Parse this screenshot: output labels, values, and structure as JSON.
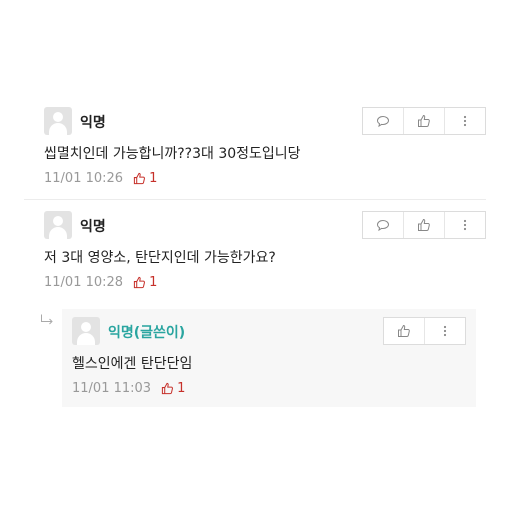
{
  "comments": [
    {
      "author": "익명",
      "text": "씹멸치인데 가능합니까??3대 30정도입니당",
      "date": "11/01 10:26",
      "likes": "1"
    },
    {
      "author": "익명",
      "text": "저 3대 영양소, 탄단지인데 가능한가요?",
      "date": "11/01 10:28",
      "likes": "1"
    }
  ],
  "reply": {
    "author": "익명(글쓴이)",
    "text": "헬스인에겐 탄단단임",
    "date": "11/01 11:03",
    "likes": "1"
  },
  "icons": {
    "comment": "speech-bubble-icon",
    "like": "thumbs-up-icon",
    "more": "more-vertical-icon",
    "reply": "reply-arrow-icon",
    "avatar": "default-avatar-icon"
  },
  "colors": {
    "like": "#c6302a",
    "writer": "#2aa5a0",
    "meta": "#999999",
    "reply_bg": "#f7f7f7"
  }
}
